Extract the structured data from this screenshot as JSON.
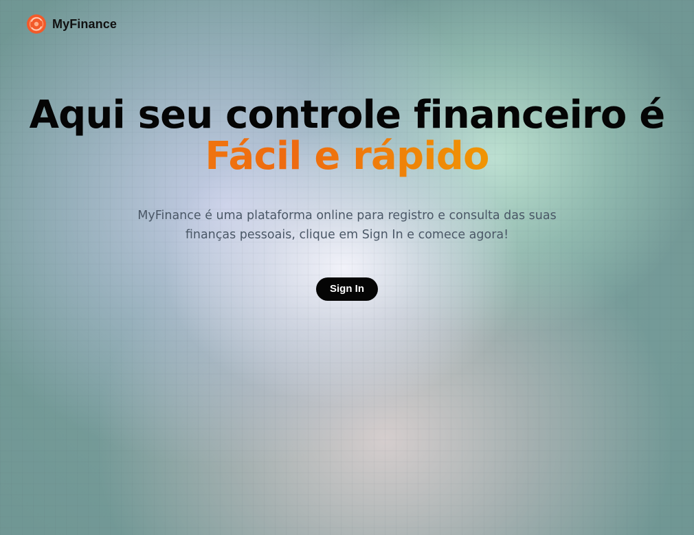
{
  "header": {
    "brand_name": "MyFinance",
    "logo_icon": "finance-logo-icon",
    "logo_color": "#f25a2a"
  },
  "hero": {
    "headline_line1": "Aqui seu controle financeiro é",
    "headline_line2": "Fácil e rápido",
    "description": "MyFinance é uma plataforma online para registro e consulta das suas finanças pessoais, clique em Sign In e comece agora!",
    "cta_label": "Sign In",
    "accent_gradient": [
      "#f28c10",
      "#ee6a10",
      "#f0a000",
      "#e9b800"
    ]
  }
}
